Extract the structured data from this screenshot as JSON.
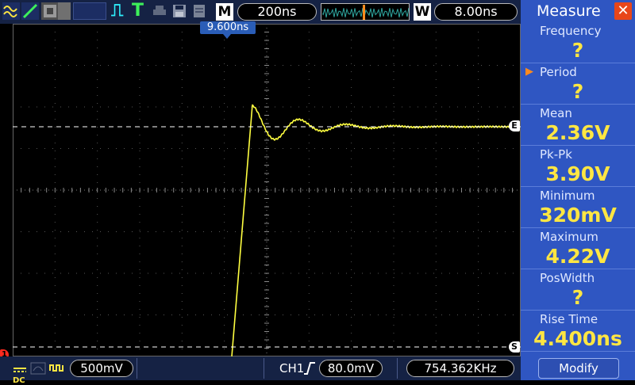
{
  "top_bar": {
    "acquire_icon": "waveform-icon",
    "mode_glyph_run": "⎍",
    "mode_glyph_trigger": "T",
    "m_badge": "M",
    "timebase": "200ns",
    "w_badge": "W",
    "window_timebase": "8.00ns"
  },
  "trigger_time": "9.600ns",
  "bottom_bar": {
    "coupling": "DC",
    "ch1_scale": "500mV",
    "trigger_channel": "CH1",
    "trigger_level": "80.0mV",
    "frequency": "754.362KHz"
  },
  "markers": {
    "channel": "1",
    "level_e": "E",
    "level_s": "S"
  },
  "panel": {
    "title": "Measure",
    "close": "✕",
    "items": [
      {
        "label": "Frequency",
        "value": "?",
        "selected": false
      },
      {
        "label": "Period",
        "value": "?",
        "selected": true
      },
      {
        "label": "Mean",
        "value": "2.36V",
        "selected": false
      },
      {
        "label": "Pk-Pk",
        "value": "3.90V",
        "selected": false
      },
      {
        "label": "Minimum",
        "value": "320mV",
        "selected": false
      },
      {
        "label": "Maximum",
        "value": "4.22V",
        "selected": false
      },
      {
        "label": "PosWidth",
        "value": "?",
        "selected": false
      },
      {
        "label": "Rise Time",
        "value": "4.400ns",
        "selected": false
      }
    ],
    "selected_marker": "▶",
    "modify": "Modify"
  },
  "colors": {
    "trace": "#ffff40",
    "panel_bg": "#2f56c2",
    "value_text": "#ffe642",
    "bar_bg": "#152244",
    "trigger_tag": "#2a5db7"
  }
}
